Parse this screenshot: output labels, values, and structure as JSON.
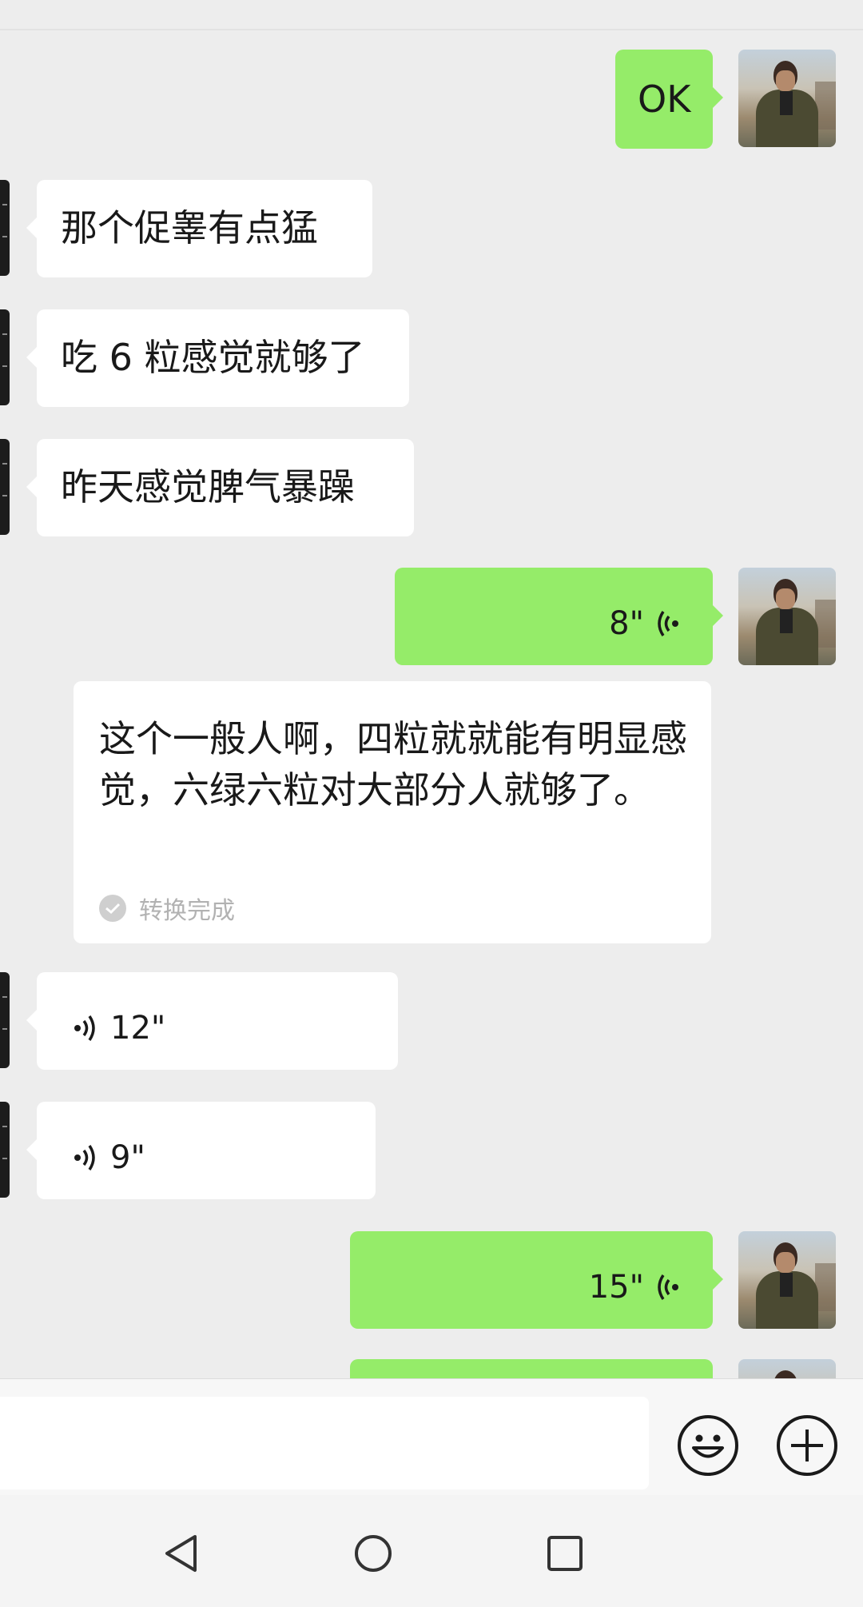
{
  "messages": {
    "m1": {
      "text": "OK"
    },
    "m2": {
      "text": "那个促睾有点猛"
    },
    "m3": {
      "text": "吃 6 粒感觉就够了"
    },
    "m4": {
      "text": "昨天感觉脾气暴躁"
    },
    "m5": {
      "duration": "8\""
    },
    "m5_transcript": {
      "text": "这个一般人啊，四粒就就能有明显感觉，六绿六粒对大部分人就够了。",
      "status": "转换完成"
    },
    "m6": {
      "duration": "12\""
    },
    "m7": {
      "duration": "9\""
    },
    "m8": {
      "duration": "15\""
    }
  },
  "icons": {
    "emoji": "emoji-icon",
    "more": "plus-circle-icon",
    "back": "nav-back-icon",
    "home": "nav-home-icon",
    "recents": "nav-recents-icon"
  },
  "colors": {
    "outgoing": "#95ec69",
    "incoming": "#ffffff",
    "background": "#ededed"
  }
}
